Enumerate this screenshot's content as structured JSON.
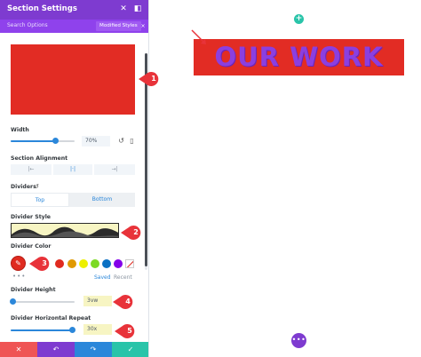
{
  "header": {
    "title": "Section Settings",
    "close_icon": "close-icon",
    "expand_icon": "expand-icon"
  },
  "tabs": {
    "search_label": "Search Options",
    "modified_label": "Modified Styles",
    "modified_close": "×"
  },
  "width": {
    "label": "Width",
    "value": "70%",
    "fraction": 0.7
  },
  "alignment": {
    "label": "Section Alignment",
    "options": [
      "align-left-icon",
      "align-center-icon",
      "align-right-icon"
    ],
    "glyphs": [
      "|←",
      "|·|",
      "→|"
    ],
    "active_index": 1
  },
  "dividers": {
    "label": "Dividers",
    "tabs": [
      "Top",
      "Bottom"
    ],
    "active_tab": 0
  },
  "divider_style": {
    "label": "Divider Style"
  },
  "divider_color": {
    "label": "Divider Color",
    "selected": "#e02b20",
    "swatches": [
      "#e02b20",
      "#e09900",
      "#edf000",
      "#7cda24",
      "#0c71c3",
      "#8300e9"
    ],
    "saved_label": "Saved",
    "recent_label": "Recent",
    "more": "•••"
  },
  "divider_height": {
    "label": "Divider Height",
    "value": "3vw",
    "fraction": 0.04
  },
  "divider_repeat": {
    "label": "Divider Horizontal Repeat",
    "value": "30x",
    "fraction": 0.97
  },
  "callouts": [
    "1",
    "2",
    "3",
    "4",
    "5"
  ],
  "footer": {
    "buttons": [
      {
        "name": "discard-button",
        "glyph": "✕",
        "color": "#ef5555"
      },
      {
        "name": "undo-button",
        "glyph": "↶",
        "color": "#7e3bd0"
      },
      {
        "name": "redo-button",
        "glyph": "↷",
        "color": "#2b87da"
      },
      {
        "name": "save-button",
        "glyph": "✓",
        "color": "#29c4a9"
      }
    ]
  },
  "canvas": {
    "heading": "OUR WORK",
    "add_glyph": "+",
    "more_glyph": "•••"
  },
  "colors": {
    "accent": "#7e3bd0",
    "panel_tab": "#8f42ec",
    "section_bg": "#e22c24",
    "heading": "#8b3fe0",
    "callout": "#e8333a",
    "highlight": "#f7f5c3"
  }
}
